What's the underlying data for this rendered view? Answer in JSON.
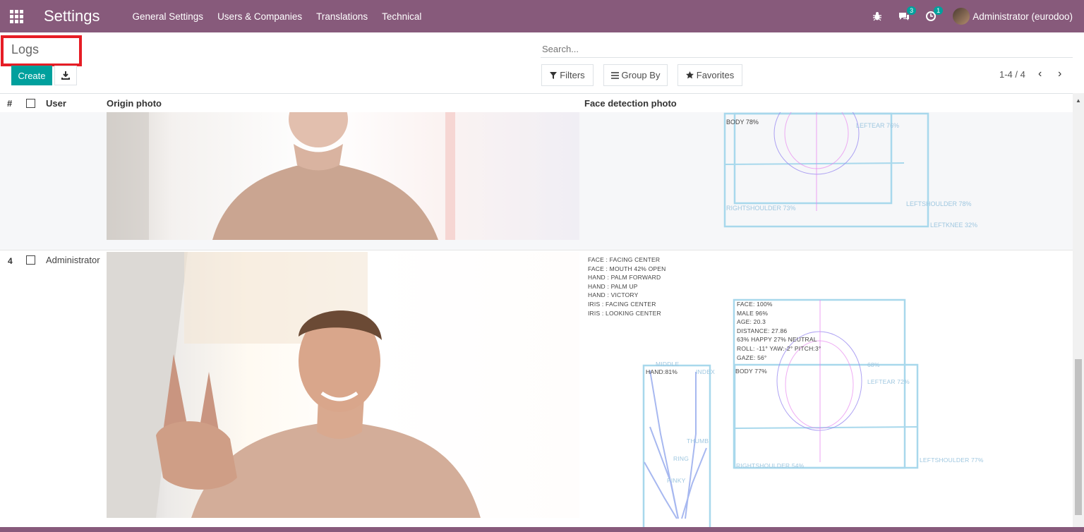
{
  "navbar": {
    "app_title": "Settings",
    "menu": [
      "General Settings",
      "Users & Companies",
      "Translations",
      "Technical"
    ],
    "messages_badge": "3",
    "activities_badge": "1",
    "user": "Administrator (eurodoo)"
  },
  "control_panel": {
    "breadcrumb": "Logs",
    "create_label": "Create",
    "search_placeholder": "Search...",
    "filters_label": "Filters",
    "group_by_label": "Group By",
    "favorites_label": "Favorites",
    "pager": "1-4 / 4"
  },
  "list": {
    "headers": {
      "num": "#",
      "user": "User",
      "origin": "Origin photo",
      "face": "Face detection photo"
    },
    "rows": [
      {
        "num": "",
        "user": "",
        "detection_labels": [
          "BODY 78%",
          "LEFTEAR 76%",
          "RIGHTSHOULDER 73%",
          "LEFTSHOULDER 78%",
          "LEFTKNEE 32%"
        ]
      },
      {
        "num": "4",
        "user": "Administrator",
        "gestures": [
          "FACE : FACING CENTER",
          "FACE : MOUTH 42% OPEN",
          "HAND : PALM FORWARD",
          "HAND : PALM UP",
          "HAND : VICTORY",
          "IRIS : FACING CENTER",
          "IRIS : LOOKING CENTER"
        ],
        "face_stats": [
          "FACE: 100%",
          "MALE 96%",
          "AGE: 20.3",
          "DISTANCE: 27.86",
          "63% HAPPY 27% NEUTRAL",
          "ROLL: -11° YAW:-2° PITCH:3°",
          "GAZE: 56°"
        ],
        "body_label": "BODY 77%",
        "hand_label": "HAND:81%",
        "finger_labels": [
          "MIDDLE",
          "INDEX",
          "THUMB",
          "RING",
          "PINKY"
        ],
        "other_labels": [
          "LEFTEAR 72%",
          "RIGHTSHOULDER 54%",
          "LEFTSHOULDER 77%",
          "68%"
        ]
      }
    ]
  },
  "colors": {
    "navbar": "#875a7b",
    "primary": "#00a09d",
    "highlight_box": "#e61d25"
  }
}
